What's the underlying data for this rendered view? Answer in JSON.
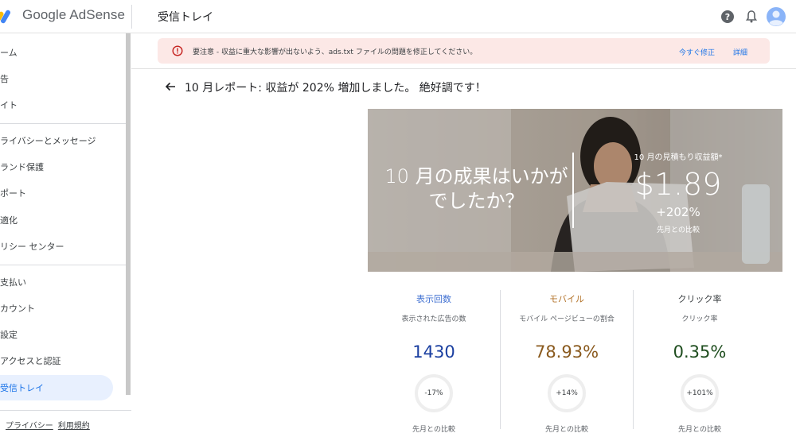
{
  "app": {
    "product_name": "Google AdSense",
    "page_title": "受信トレイ"
  },
  "sidebar": {
    "items": [
      {
        "label": "ーム"
      },
      {
        "label": "告"
      },
      {
        "label": "イト"
      },
      {
        "label": "ライバシーとメッセージ"
      },
      {
        "label": "ランド保護"
      },
      {
        "label": "ポート"
      },
      {
        "label": "適化"
      },
      {
        "label": "リシー センター"
      },
      {
        "label": "支払い"
      },
      {
        "label": "カウント"
      },
      {
        "label": "設定"
      },
      {
        "label": "アクセスと認証"
      },
      {
        "label": "受信トレイ",
        "active": true
      }
    ],
    "footer": {
      "privacy": "プライバシー",
      "terms": "利用規約"
    }
  },
  "alert": {
    "text": "要注意 - 収益に重大な影響が出ないよう、ads.txt ファイルの問題を修正してください。",
    "fix_now": "今すぐ修正",
    "details": "詳細"
  },
  "report": {
    "title": "10 月レポート: 収益が 202% 増加しました。 絶好調です！"
  },
  "hero": {
    "question": "10 月の成果はいかがでしたか？",
    "estimate_label": "10 月の見積もり収益額*",
    "amount": "$1.89",
    "change": "+202%",
    "comparison": "先月との比較"
  },
  "stats": [
    {
      "title": "表示回数",
      "subtitle": "表示された広告の数",
      "value": "1430",
      "change": "-17%",
      "comparison": "先月との比較",
      "color": "#1a3fa0",
      "title_color": "#3f6fd1"
    },
    {
      "title": "モバイル",
      "subtitle": "モバイル ページビューの割合",
      "value": "78.93%",
      "change": "+14%",
      "comparison": "先月との比較",
      "color": "#8a5a1e",
      "title_color": "#b3732a"
    },
    {
      "title": "クリック率",
      "subtitle": "クリック率",
      "value": "0.35%",
      "change": "+101%",
      "comparison": "先月との比較",
      "color": "#1e4d1e",
      "title_color": "#3c4043"
    }
  ],
  "icons": {
    "help": "help-icon",
    "bell": "notifications-icon",
    "avatar": "account-avatar-icon",
    "alert": "error-outline-icon",
    "back": "arrow-back-icon"
  }
}
